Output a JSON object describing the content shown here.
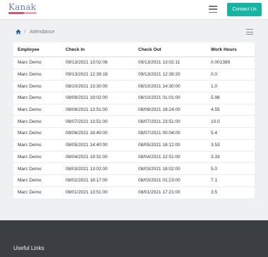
{
  "brand": {
    "name": "Kanak"
  },
  "header": {
    "contact_button": "Contact Us"
  },
  "breadcrumb": {
    "separator": "/",
    "current": "Attendance"
  },
  "table": {
    "columns": [
      "Employee",
      "Check In",
      "Check Out",
      "Work Hours"
    ],
    "rows": [
      [
        "Marc Demo",
        "09/13/2021 13:02:06",
        "09/13/2021 13:02:11",
        "0.001389"
      ],
      [
        "Marc Demo",
        "09/13/2021 12:39:18",
        "09/13/2021 12:39:20",
        "0.0"
      ],
      [
        "Marc Demo",
        "08/10/2021 13:30:00",
        "08/10/2021 14:30:00",
        "1.0"
      ],
      [
        "Marc Demo",
        "08/09/2021 19:02:00",
        "08/10/2021 01:01:00",
        "5.98"
      ],
      [
        "Marc Demo",
        "08/08/2021 13:51:00",
        "08/08/2021 18:24:00",
        "4.55"
      ],
      [
        "Marc Demo",
        "08/07/2021 13:51:00",
        "08/07/2021 23:51:00",
        "10.0"
      ],
      [
        "Marc Demo",
        "08/06/2021 18:40:00",
        "08/07/2021 00:04:00",
        "5.4"
      ],
      [
        "Marc Demo",
        "08/05/2021 14:40:00",
        "08/05/2021 18:12:00",
        "3.53"
      ],
      [
        "Marc Demo",
        "08/04/2021 19:31:00",
        "08/04/2021 22:51:00",
        "3.33"
      ],
      [
        "Marc Demo",
        "08/03/2021 13:02:00",
        "08/03/2021 18:02:00",
        "5.0"
      ],
      [
        "Marc Demo",
        "08/02/2021 18:17:00",
        "08/03/2021 01:23:00",
        "7.1"
      ],
      [
        "Marc Demo",
        "08/01/2021 13:51:00",
        "08/01/2021 17:21:00",
        "3.5"
      ]
    ]
  },
  "footer": {
    "title": "Useful Links"
  },
  "colors": {
    "accent": "#17b3a3",
    "footer_bg": "#3b3e42",
    "page_bg": "#eef0f2"
  },
  "icons": {
    "home": "home-icon",
    "menu": "hamburger-menu-icon",
    "list": "list-view-icon"
  }
}
